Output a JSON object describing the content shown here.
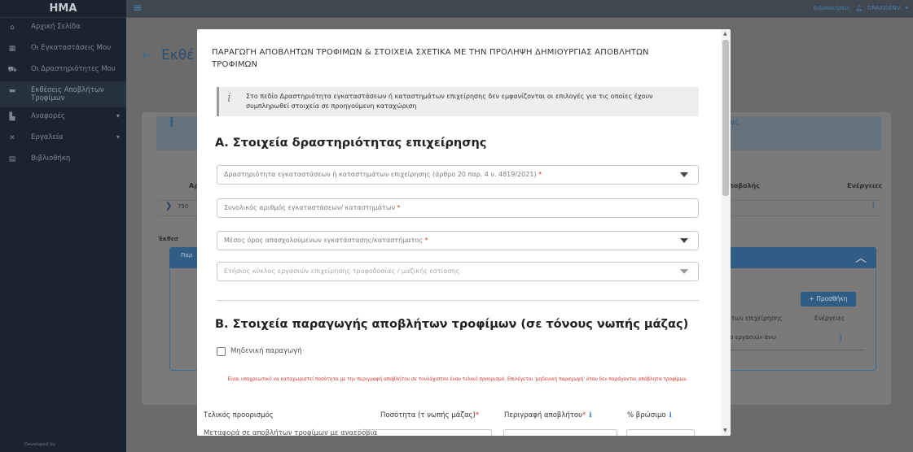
{
  "app": {
    "brand": "HMA",
    "footer": "Developed by",
    "sidebar": [
      {
        "icon": "home-icon",
        "glyph": "⌂",
        "label": "Αρχική Σελίδα"
      },
      {
        "icon": "building-icon",
        "glyph": "▦",
        "label": "Οι Εγκαταστάσεις Μου"
      },
      {
        "icon": "truck-icon",
        "glyph": "⛟",
        "label": "Οι Δραστηριότητες Μου"
      },
      {
        "icon": "folder-icon",
        "glyph": "▬",
        "label": "Εκθέσεις Αποβλήτων Τροφίμων"
      },
      {
        "icon": "chart-icon",
        "glyph": "▙",
        "label": "Αναφορές"
      },
      {
        "icon": "tools-icon",
        "glyph": "✕",
        "label": "Εργαλεία"
      },
      {
        "icon": "book-icon",
        "glyph": "▤",
        "label": "Βιβλιοθήκη"
      }
    ],
    "topbar": {
      "notifications": "Ειδοποιήσεις",
      "user": "DRAXISENV"
    }
  },
  "background": {
    "page_title": "Εκθέ",
    "info_snippet": "μίας.",
    "row_id": "750",
    "sub_title": "Έκθεσ",
    "sub_head": "Παρ",
    "add_button": "+ Προσθήκη",
    "cols": {
      "type": "Αρ",
      "submission": "υποβολής",
      "actions": "Ενέργειες"
    },
    "sub_cols": {
      "activity": "μάτων επιχείρησης",
      "actions": "Ενέργειες"
    },
    "sub_cell": "κλο εργασιών άνω"
  },
  "modal": {
    "title": "ΠΑΡΑΓΩΓΗ ΑΠΟΒΛΗΤΩΝ ΤΡΟΦΙΜΩΝ & ΣΤΟΙΧΕΙΑ ΣΧΕΤΙΚΑ ΜΕ ΤΗΝ ΠΡΟΛΗΨΗ ΔΗΜΙΟΥΡΓΙΑΣ ΑΠΟΒΛΗΤΩΝ ΤΡΟΦΙΜΩΝ",
    "notice": "Στο πεδίο Δραστηριότητα εγκαταστάσεων ή καταστημάτων επιχείρησης δεν εμφανίζονται οι επιλογές για τις οποίες έχουν συμπληρωθεί στοιχεία σε προηγούμενη καταχώριση",
    "section_a": "Α. Στοιχεία δραστηριότητας επιχείρησης",
    "fields": {
      "activity": "Δραστηριότητα εγκαταστάσεων ή καταστημάτων επιχείρησης (άρθρο 20 παρ. 4 ν. 4819/2021)",
      "count": "Συνολικός αριθμός εγκαταστάσεων/ καταστημάτων",
      "employees": "Μέσος όρος απασχολούμενων εγκατάστασης/καταστήματος",
      "turnover": "Ετήσιος κύκλος εργασιών επιχείρησης τροφοδοσίας / μαζικής εστίασης"
    },
    "required_mark": "*",
    "section_b": "Β. Στοιχεία παραγωγής αποβλήτων τροφίμων (σε τόνους νωπής μάζας)",
    "zero_production": "Μηδενική παραγωγή",
    "warning": "Είναι υποχρεωτικό να καταχωριστεί ποσότητα με την περιγραφή αποβλήτου σε τουλάχιστον έναν τελικό προορισμό. Επιλέγεται 'μηδενική παραγωγή' όταν δεν παράγονται απόβλητα τροφίμων.",
    "table_headers": {
      "destination": "Τελικός προορισμός",
      "quantity": "Ποσότητα (τ νωπής μάζας)",
      "description": "Περιγραφή αποβλήτου",
      "edible": "% βρώσιμο"
    },
    "info_glyph": "i",
    "cut_row": "Μεταφορά σε αποβλήτων τροφίμων με αναερόβια"
  }
}
